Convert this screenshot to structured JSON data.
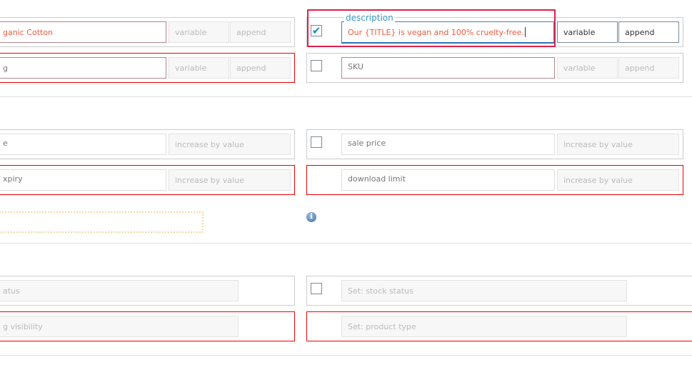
{
  "left_rows": [
    {
      "value": "ganic Cotton",
      "mode": "variable",
      "action": "append"
    },
    {
      "value": "g",
      "mode": "variable",
      "action": "append"
    },
    {
      "value": "e",
      "action": "increase by value"
    },
    {
      "value": "xpiry",
      "action": "increase by value"
    },
    {
      "value": "atus"
    },
    {
      "value": "g visibility"
    }
  ],
  "right_rows": [
    {
      "legend": "description",
      "value": "Our {TITLE} is vegan and 100% cruelty-free.",
      "mode": "variable",
      "action": "append",
      "checked": true
    },
    {
      "value": "SKU",
      "mode": "variable",
      "action": "append",
      "checked": false
    },
    {
      "value": "sale price",
      "action": "increase by value",
      "checked": false
    },
    {
      "value": "download limit",
      "action": "increase by value"
    },
    {
      "value": "Set: stock status",
      "checked": false
    },
    {
      "value": "Set: product type"
    }
  ],
  "colors": {
    "error_border": "#ee0000",
    "focus_border": "#e0204a",
    "value_text": "#f05a3c",
    "legend": "#3a95c9",
    "check": "#1e8cbe"
  },
  "icons": {
    "info": "info-icon",
    "check": "checkmark-icon"
  }
}
